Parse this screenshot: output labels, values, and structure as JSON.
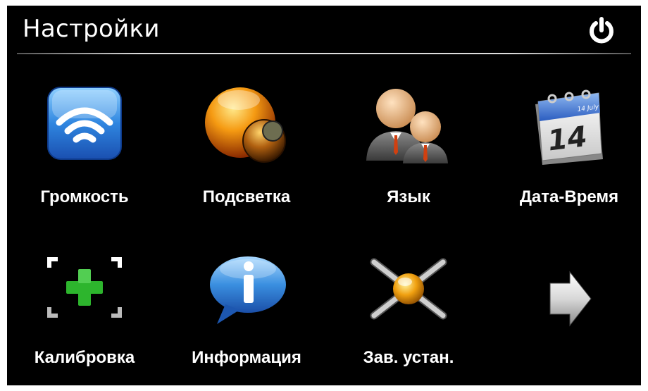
{
  "header": {
    "title": "Настройки",
    "power_icon": "power-icon"
  },
  "menu": {
    "items": [
      {
        "label": "Громкость",
        "icon": "volume-wifi-icon"
      },
      {
        "label": "Подсветка",
        "icon": "backlight-orb-icon"
      },
      {
        "label": "Язык",
        "icon": "language-people-icon"
      },
      {
        "label": "Дата-Время",
        "icon": "calendar-icon"
      },
      {
        "label": "Калибровка",
        "icon": "calibration-crosshair-icon"
      },
      {
        "label": "Информация",
        "icon": "info-bubble-icon"
      },
      {
        "label": "Зав. устан.",
        "icon": "factory-reset-icon"
      }
    ],
    "next_icon": "next-arrow-icon",
    "calendar_day": "14",
    "calendar_month": "14 July"
  },
  "colors": {
    "background": "#000000",
    "text": "#ffffff",
    "accent_blue": "#2f86e0",
    "accent_orange": "#f08a10",
    "accent_green": "#22aa22"
  }
}
